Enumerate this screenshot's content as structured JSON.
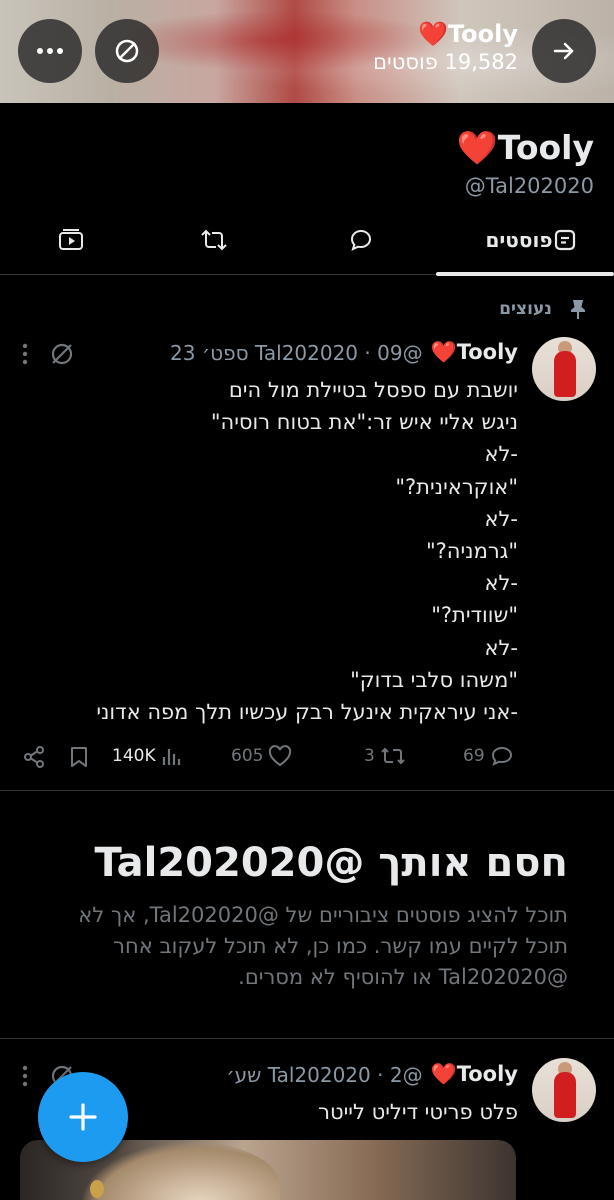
{
  "header": {
    "name": "❤️Tooly",
    "post_count": "19,582 פוסטים"
  },
  "profile": {
    "name": "❤️Tooly",
    "handle": "@Tal202020"
  },
  "tabs": [
    {
      "label": "פוסטים",
      "icon": "posts-icon",
      "selected": true
    },
    {
      "label": "",
      "icon": "reply-icon"
    },
    {
      "label": "",
      "icon": "repost-icon"
    },
    {
      "label": "",
      "icon": "media-icon"
    }
  ],
  "pinned": {
    "label": "נעוצים"
  },
  "tweets": [
    {
      "name": "❤️Tooly",
      "meta": "@Tal202020 · 09 ספט׳ 23",
      "lines": [
        "יושבת עם ספסל בטיילת מול הים",
        "ניגש אליי איש זר:\"את בטוח רוסיה\"",
        "-לא",
        "\"אוקראינית?\"",
        "-לא",
        "\"גרמניה?\"",
        "-לא",
        "\"שוודית?\"",
        "-לא",
        "\"משהו סלבי בדוק\"",
        "-אני עיראקית אינעל רבק עכשיו תלך מפה אדוני"
      ],
      "stats": {
        "replies": "69",
        "reposts": "3",
        "likes": "605",
        "views": "140K"
      }
    },
    {
      "name": "❤️Tooly",
      "meta": "@Tal202020 · 2 שע׳",
      "lines": [
        "פלט פריטי דיליט לייטר"
      ]
    }
  ],
  "block_notice": {
    "title": "חסם אותך @Tal202020",
    "description": "תוכל להציג פוסטים ציבוריים של @Tal202020, אך לא תוכל לקיים עמו קשר. כמו כן, לא תוכל לעקוב אחר @Tal202020 או להוסיף לא מסרים."
  },
  "colors": {
    "background": "#000000",
    "text": "#e7e9ea",
    "secondary_text": "#8b98a5",
    "accent": "#1d9bf0",
    "divider": "#2f3336"
  }
}
